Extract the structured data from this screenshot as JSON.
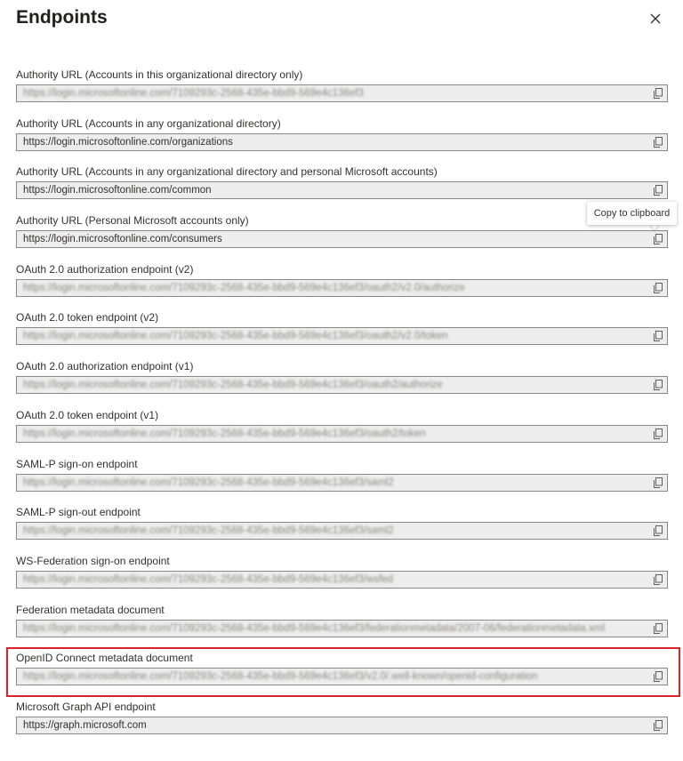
{
  "panel": {
    "title": "Endpoints"
  },
  "tooltip": {
    "text": "Copy to clipboard"
  },
  "colors": {
    "highlight": "#d9232a",
    "field_background": "#ededed",
    "field_border": "#8a8886"
  },
  "icons": {
    "close": "close-icon",
    "copy": "copy-icon"
  },
  "endpoints": [
    {
      "label": "Authority URL (Accounts in this organizational directory only)",
      "value": "https://login.microsoftonline.com/7109293c-2568-435e-bbd9-569e4c136ef3",
      "redacted": true
    },
    {
      "label": "Authority URL (Accounts in any organizational directory)",
      "value": "https://login.microsoftonline.com/organizations",
      "redacted": false
    },
    {
      "label": "Authority URL (Accounts in any organizational directory and personal Microsoft accounts)",
      "value": "https://login.microsoftonline.com/common",
      "redacted": false
    },
    {
      "label": "Authority URL (Personal Microsoft accounts only)",
      "value": "https://login.microsoftonline.com/consumers",
      "redacted": false
    },
    {
      "label": "OAuth 2.0 authorization endpoint (v2)",
      "value": "https://login.microsoftonline.com/7109293c-2568-435e-bbd9-569e4c136ef3/oauth2/v2.0/authorize",
      "redacted": true
    },
    {
      "label": "OAuth 2.0 token endpoint (v2)",
      "value": "https://login.microsoftonline.com/7109293c-2568-435e-bbd9-569e4c136ef3/oauth2/v2.0/token",
      "redacted": true
    },
    {
      "label": "OAuth 2.0 authorization endpoint (v1)",
      "value": "https://login.microsoftonline.com/7109293c-2568-435e-bbd9-569e4c136ef3/oauth2/authorize",
      "redacted": true
    },
    {
      "label": "OAuth 2.0 token endpoint (v1)",
      "value": "https://login.microsoftonline.com/7109293c-2568-435e-bbd9-569e4c136ef3/oauth2/token",
      "redacted": true
    },
    {
      "label": "SAML-P sign-on endpoint",
      "value": "https://login.microsoftonline.com/7109293c-2568-435e-bbd9-569e4c136ef3/saml2",
      "redacted": true
    },
    {
      "label": "SAML-P sign-out endpoint",
      "value": "https://login.microsoftonline.com/7109293c-2568-435e-bbd9-569e4c136ef3/saml2",
      "redacted": true
    },
    {
      "label": "WS-Federation sign-on endpoint",
      "value": "https://login.microsoftonline.com/7109293c-2568-435e-bbd9-569e4c136ef3/wsfed",
      "redacted": true
    },
    {
      "label": "Federation metadata document",
      "value": "https://login.microsoftonline.com/7109293c-2568-435e-bbd9-569e4c136ef3/federationmetadata/2007-06/federationmetadata.xml",
      "redacted": true
    },
    {
      "label": "OpenID Connect metadata document",
      "value": "https://login.microsoftonline.com/7109293c-2568-435e-bbd9-569e4c136ef3/v2.0/.well-known/openid-configuration",
      "redacted": true
    },
    {
      "label": "Microsoft Graph API endpoint",
      "value": "https://graph.microsoft.com",
      "redacted": false
    }
  ]
}
